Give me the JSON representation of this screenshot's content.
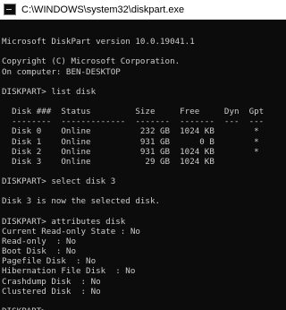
{
  "window": {
    "title": "C:\\WINDOWS\\system32\\diskpart.exe",
    "icon": "console-icon"
  },
  "console": {
    "prompt": "DISKPART> ",
    "lines": [
      "",
      "Microsoft DiskPart version 10.0.19041.1",
      "",
      "Copyright (C) Microsoft Corporation.",
      "On computer: BEN-DESKTOP",
      "",
      "DISKPART> list disk",
      "",
      "  Disk ###  Status         Size     Free     Dyn  Gpt",
      "  --------  -------------  -------  -------  ---  ---",
      "  Disk 0    Online          232 GB  1024 KB        *",
      "  Disk 1    Online          931 GB      0 B        *",
      "  Disk 2    Online          931 GB  1024 KB        *",
      "  Disk 3    Online           29 GB  1024 KB",
      "",
      "DISKPART> select disk 3",
      "",
      "Disk 3 is now the selected disk.",
      "",
      "DISKPART> attributes disk",
      "Current Read-only State : No",
      "Read-only  : No",
      "Boot Disk  : No",
      "Pagefile Disk  : No",
      "Hibernation File Disk  : No",
      "Crashdump Disk  : No",
      "Clustered Disk  : No",
      "",
      "DISKPART> "
    ]
  }
}
